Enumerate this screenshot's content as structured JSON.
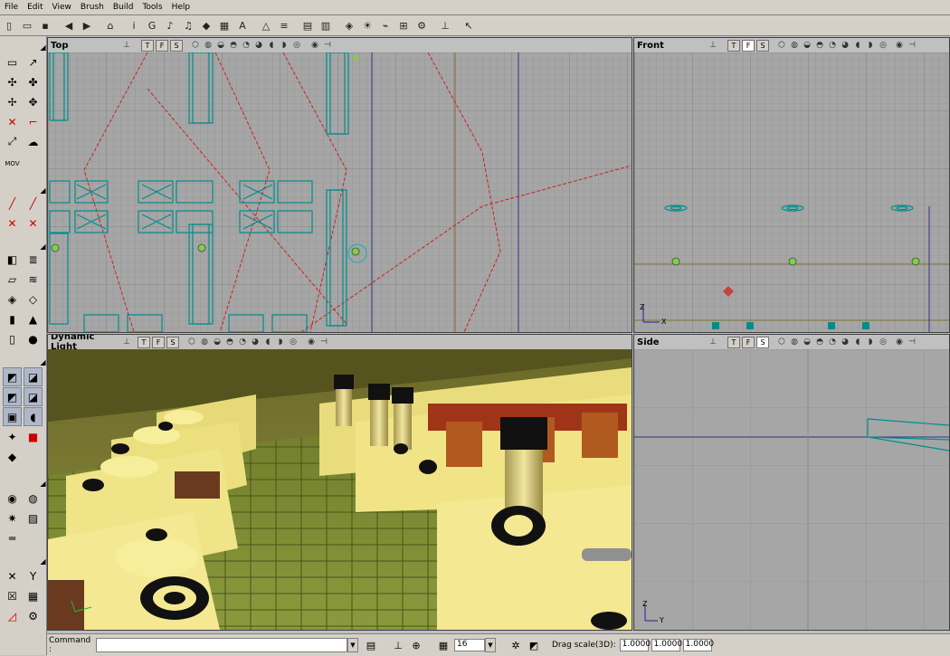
{
  "menu": {
    "items": [
      "File",
      "Edit",
      "View",
      "Brush",
      "Build",
      "Tools",
      "Help"
    ]
  },
  "toolbar": {
    "icons": [
      "new-file-icon",
      "open-file-icon",
      "save-file-icon",
      "undo-icon",
      "redo-icon",
      "browser-icon",
      "actor-class-icon",
      "group-icon",
      "sound-icon",
      "music-icon",
      "mesh-icon",
      "texture-icon",
      "font-icon",
      "prefab-icon",
      "surface-props-icon",
      "actor-props-icon",
      "level-props-icon",
      "build-geometry-icon",
      "build-lighting-icon",
      "build-paths-icon",
      "build-all-icon",
      "build-options-icon",
      "play-icon",
      "help-icon"
    ]
  },
  "viewports": {
    "top": {
      "title": "Top"
    },
    "front": {
      "title": "Front"
    },
    "dynamic": {
      "title": "Dynamic Light"
    },
    "side": {
      "title": "Side"
    }
  },
  "statusbar": {
    "command_label": "Command :",
    "grid_value": "16",
    "drag_scale_label": "Drag scale(3D):",
    "drag_x": "1.0000",
    "drag_y": "1.0000",
    "drag_z": "1.0000"
  },
  "axis": {
    "x": "X",
    "y": "Y",
    "z": "Z"
  },
  "colors": {
    "mesh": "#008c8c",
    "path": "#cc2020",
    "floor": "#5a6a1c",
    "machine": "#e8dc78"
  }
}
